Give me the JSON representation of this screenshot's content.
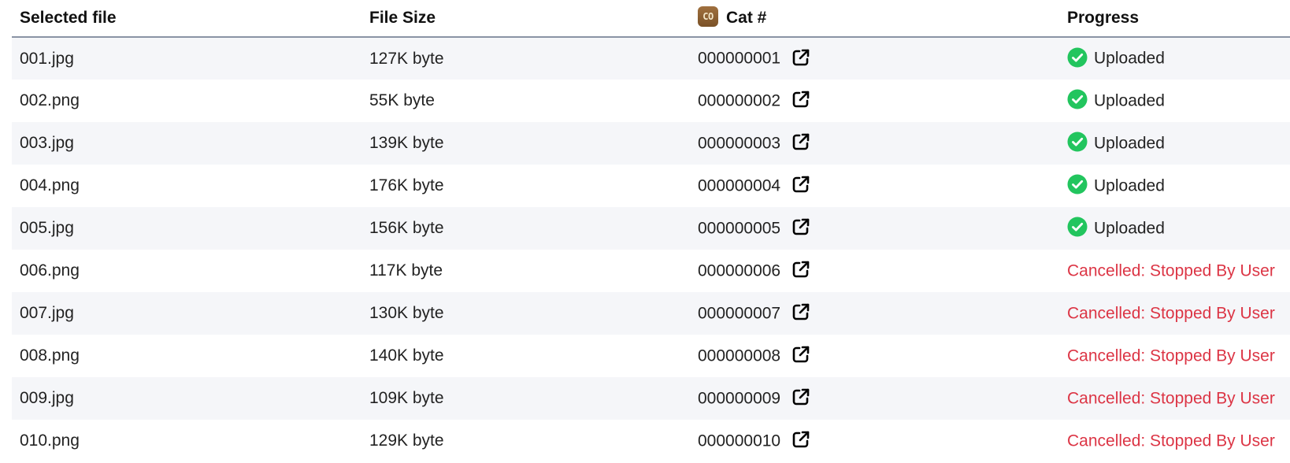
{
  "table": {
    "headers": {
      "file": "Selected file",
      "size": "File Size",
      "cat_badge": "CO",
      "cat": "Cat #",
      "progress": "Progress"
    },
    "rows": [
      {
        "file": "001.jpg",
        "size": "127K byte",
        "cat": "000000001",
        "status": "Uploaded",
        "state": "uploaded"
      },
      {
        "file": "002.png",
        "size": "55K byte",
        "cat": "000000002",
        "status": "Uploaded",
        "state": "uploaded"
      },
      {
        "file": "003.jpg",
        "size": "139K byte",
        "cat": "000000003",
        "status": "Uploaded",
        "state": "uploaded"
      },
      {
        "file": "004.png",
        "size": "176K byte",
        "cat": "000000004",
        "status": "Uploaded",
        "state": "uploaded"
      },
      {
        "file": "005.jpg",
        "size": "156K byte",
        "cat": "000000005",
        "status": "Uploaded",
        "state": "uploaded"
      },
      {
        "file": "006.png",
        "size": "117K byte",
        "cat": "000000006",
        "status": "Cancelled: Stopped By User",
        "state": "cancelled"
      },
      {
        "file": "007.jpg",
        "size": "130K byte",
        "cat": "000000007",
        "status": "Cancelled: Stopped By User",
        "state": "cancelled"
      },
      {
        "file": "008.png",
        "size": "140K byte",
        "cat": "000000008",
        "status": "Cancelled: Stopped By User",
        "state": "cancelled"
      },
      {
        "file": "009.jpg",
        "size": "109K byte",
        "cat": "000000009",
        "status": "Cancelled: Stopped By User",
        "state": "cancelled"
      },
      {
        "file": "010.png",
        "size": "129K byte",
        "cat": "000000010",
        "status": "Cancelled: Stopped By User",
        "state": "cancelled"
      }
    ]
  },
  "icons": {
    "link": "external-link-icon",
    "success": "check-circle-icon"
  },
  "colors": {
    "success": "#22c55e",
    "cancelled": "#dc3545",
    "header_rule": "#8a93a5",
    "stripe": "#f5f6f9"
  }
}
